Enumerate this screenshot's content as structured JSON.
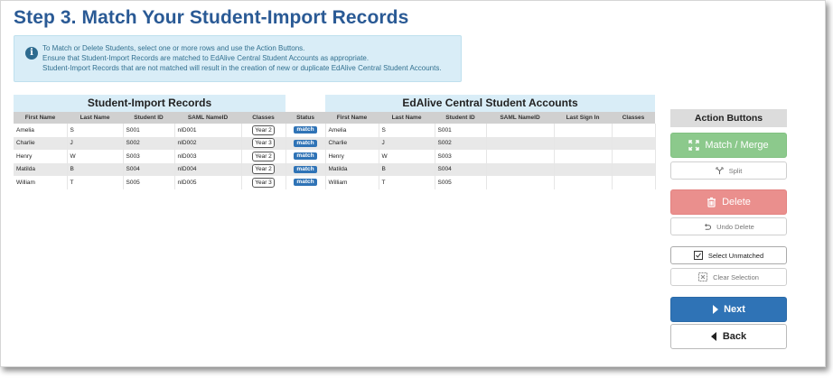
{
  "title": "Step 3. Match Your Student-Import Records",
  "info": {
    "lines": [
      "To Match or Delete Students, select one or more rows and use the Action Buttons.",
      "Ensure that Student-Import Records are matched to EdAlive Central Student Accounts as appropriate.",
      "Student-Import Records that are not matched will result in the creation of new or duplicate EdAlive Central Student Accounts."
    ]
  },
  "import_section": {
    "title": "Student-Import Records",
    "columns": [
      "First Name",
      "Last Name",
      "Student ID",
      "SAML NameID",
      "Classes"
    ]
  },
  "status_column": "Status",
  "central_section": {
    "title": "EdAlive Central Student Accounts",
    "columns": [
      "First Name",
      "Last Name",
      "Student ID",
      "SAML NameID",
      "Last Sign In",
      "Classes"
    ]
  },
  "rows": [
    {
      "import": {
        "first": "Amelia",
        "last": "S",
        "id": "S001",
        "saml": "nID001",
        "class": "Year 2"
      },
      "status": "match",
      "central": {
        "first": "Amelia",
        "last": "S",
        "id": "S001",
        "saml": "",
        "last_sign_in": "",
        "classes": ""
      }
    },
    {
      "import": {
        "first": "Charlie",
        "last": "J",
        "id": "S002",
        "saml": "nID002",
        "class": "Year 3"
      },
      "status": "match",
      "central": {
        "first": "Charlie",
        "last": "J",
        "id": "S002",
        "saml": "",
        "last_sign_in": "",
        "classes": ""
      }
    },
    {
      "import": {
        "first": "Henry",
        "last": "W",
        "id": "S003",
        "saml": "nID003",
        "class": "Year 2"
      },
      "status": "match",
      "central": {
        "first": "Henry",
        "last": "W",
        "id": "S003",
        "saml": "",
        "last_sign_in": "",
        "classes": ""
      }
    },
    {
      "import": {
        "first": "Matilda",
        "last": "B",
        "id": "S004",
        "saml": "nID004",
        "class": "Year 2"
      },
      "status": "match",
      "central": {
        "first": "Matilda",
        "last": "B",
        "id": "S004",
        "saml": "",
        "last_sign_in": "",
        "classes": ""
      }
    },
    {
      "import": {
        "first": "William",
        "last": "T",
        "id": "S005",
        "saml": "nID005",
        "class": "Year 3"
      },
      "status": "match",
      "central": {
        "first": "William",
        "last": "T",
        "id": "S005",
        "saml": "",
        "last_sign_in": "",
        "classes": ""
      }
    }
  ],
  "actions": {
    "title": "Action Buttons",
    "match_merge": "Match / Merge",
    "split": "Split",
    "delete": "Delete",
    "undo_delete": "Undo Delete",
    "select_unmatched": "Select Unmatched",
    "clear_selection": "Clear Selection",
    "next": "Next",
    "back": "Back"
  },
  "icons": {
    "info": "info-circle-icon",
    "match_merge": "merge-arrows-icon",
    "split": "split-arrows-icon",
    "delete": "trash-icon",
    "undo": "undo-arrow-icon",
    "select_unmatched": "checkbox-checked-icon",
    "clear_selection": "checkbox-cleared-icon",
    "next": "chevron-right-icon",
    "back": "chevron-left-icon"
  },
  "colors": {
    "title": "#2a5a95",
    "info_bg": "#d9edf7",
    "success": "#8cc98c",
    "danger": "#ea8f8d",
    "primary": "#2f73b6"
  }
}
